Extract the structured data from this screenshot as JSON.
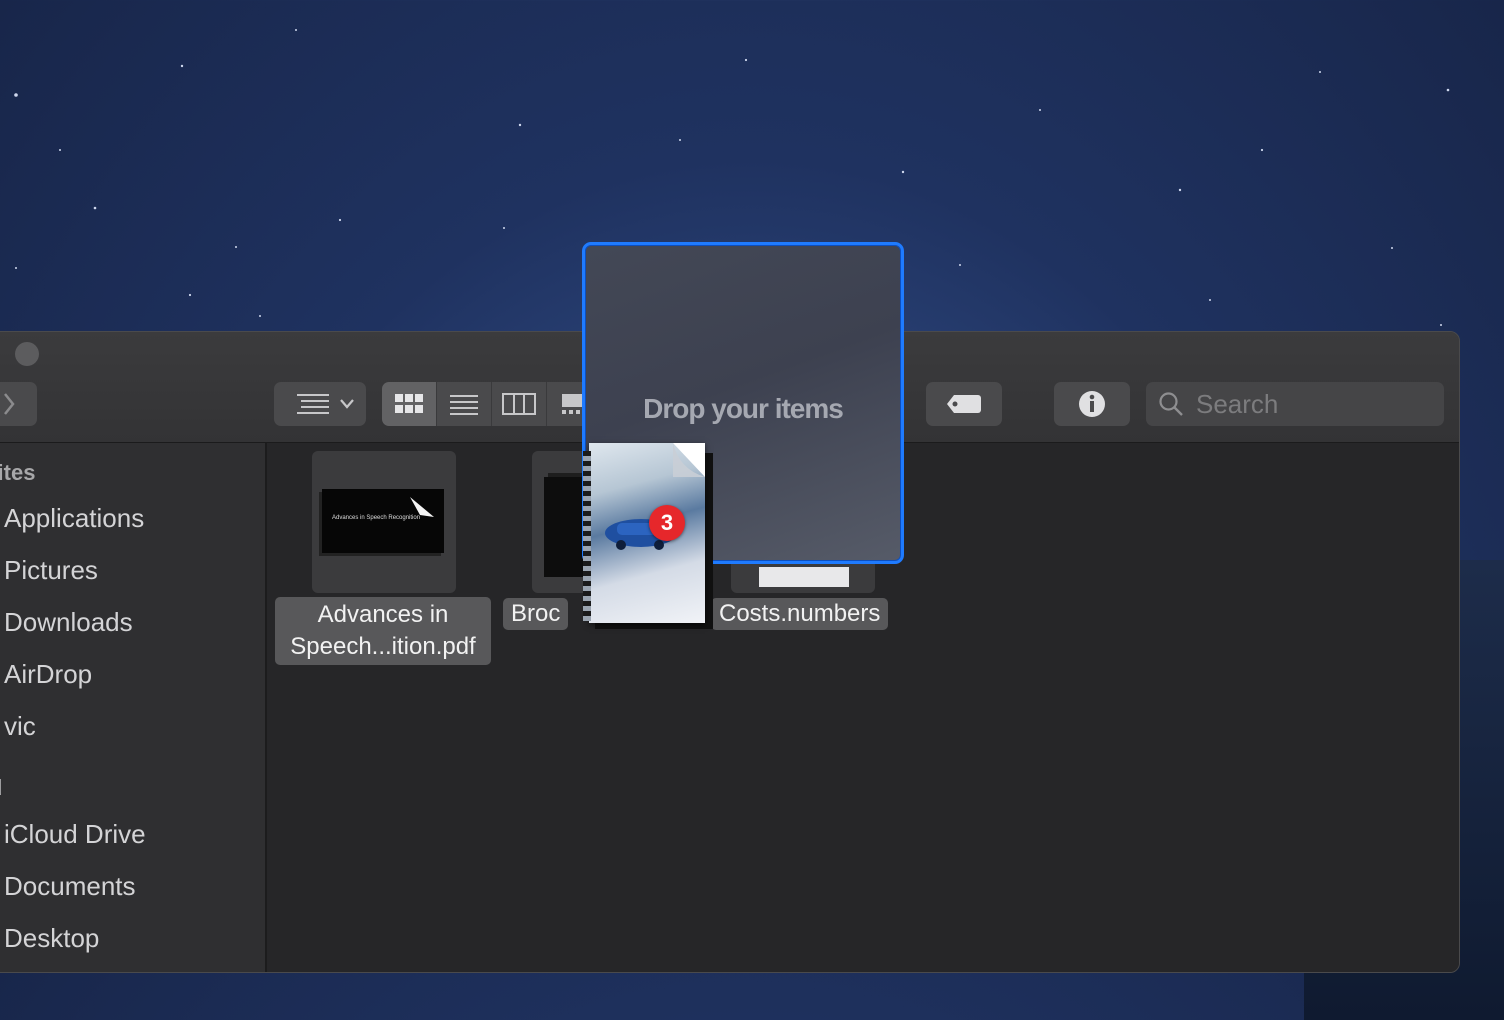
{
  "desktop": {
    "accent": "#1f7bff"
  },
  "toolbar": {
    "view_options_icon": "list-dropdown-icon",
    "view_modes": [
      "icon-view-icon",
      "list-view-icon",
      "column-view-icon",
      "gallery-view-icon"
    ],
    "active_view": "icon-view-icon",
    "tag_icon": "tag-icon",
    "info_icon": "info-icon",
    "search_placeholder": "Search"
  },
  "sidebar": {
    "favorites_header": "rites",
    "favorites": [
      "Applications",
      "Pictures",
      "Downloads",
      "AirDrop",
      "vic"
    ],
    "icloud_header": "d",
    "icloud": [
      "iCloud Drive",
      "Documents",
      "Desktop"
    ]
  },
  "files": [
    {
      "line1": "Advances in",
      "line2": "Speech...ition.pdf"
    },
    {
      "line1": "Broc"
    },
    {
      "line1": "Costs.numbers"
    }
  ],
  "thumb_text": "Advances in Speech Recognition",
  "dropzone": {
    "text": "Drop your items"
  },
  "drag": {
    "count": "3"
  }
}
